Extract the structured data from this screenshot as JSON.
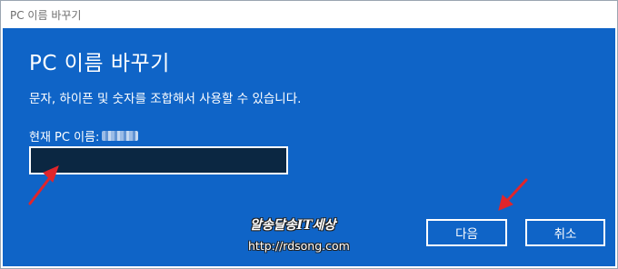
{
  "window": {
    "title": "PC 이름 바꾸기"
  },
  "dialog": {
    "heading": "PC 이름 바꾸기",
    "description": "문자, 하이픈 및 숫자를 조합해서 사용할 수 있습니다.",
    "current_name_label": "현재 PC 이름:",
    "name_input": {
      "value": "",
      "placeholder": ""
    },
    "buttons": {
      "next": "다음",
      "cancel": "취소"
    }
  },
  "watermark": {
    "title": "알송달송IT세상",
    "url": "http://rdsong.com"
  },
  "colors": {
    "accent": "#0f64c7",
    "input_bg": "#0b2742",
    "arrow": "#e0252b"
  },
  "icons": {
    "annotation": "red-arrow-icon"
  }
}
